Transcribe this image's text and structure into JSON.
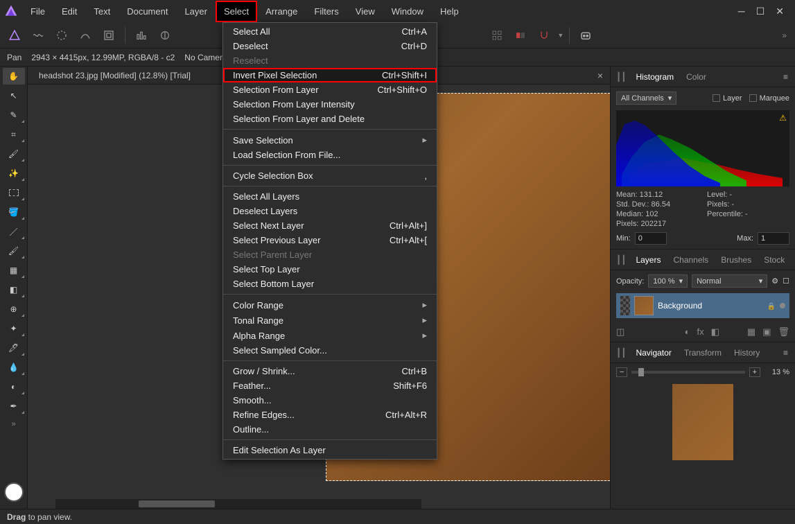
{
  "menu": [
    "File",
    "Edit",
    "Text",
    "Document",
    "Layer",
    "Select",
    "Arrange",
    "Filters",
    "View",
    "Window",
    "Help"
  ],
  "menu_selected_index": 5,
  "dropdown": {
    "groups": [
      [
        {
          "label": "Select All",
          "shortcut": "Ctrl+A"
        },
        {
          "label": "Deselect",
          "shortcut": "Ctrl+D"
        },
        {
          "label": "Reselect",
          "shortcut": "",
          "disabled": true
        },
        {
          "label": "Invert Pixel Selection",
          "shortcut": "Ctrl+Shift+I",
          "highlighted": true
        },
        {
          "label": "Selection From Layer",
          "shortcut": "Ctrl+Shift+O"
        },
        {
          "label": "Selection From Layer Intensity",
          "shortcut": ""
        },
        {
          "label": "Selection From Layer and Delete",
          "shortcut": ""
        }
      ],
      [
        {
          "label": "Save Selection",
          "shortcut": "",
          "submenu": true
        },
        {
          "label": "Load Selection From File...",
          "shortcut": ""
        }
      ],
      [
        {
          "label": "Cycle Selection Box",
          "shortcut": ",",
          "kbd": "."
        }
      ],
      [
        {
          "label": "Select All Layers",
          "shortcut": ""
        },
        {
          "label": "Deselect Layers",
          "shortcut": ""
        },
        {
          "label": "Select Next Layer",
          "shortcut": "Ctrl+Alt+]"
        },
        {
          "label": "Select Previous Layer",
          "shortcut": "Ctrl+Alt+["
        },
        {
          "label": "Select Parent Layer",
          "shortcut": "",
          "disabled": true
        },
        {
          "label": "Select Top Layer",
          "shortcut": ""
        },
        {
          "label": "Select Bottom Layer",
          "shortcut": ""
        }
      ],
      [
        {
          "label": "Color Range",
          "shortcut": "",
          "submenu": true
        },
        {
          "label": "Tonal Range",
          "shortcut": "",
          "submenu": true
        },
        {
          "label": "Alpha Range",
          "shortcut": "",
          "submenu": true
        },
        {
          "label": "Select Sampled Color...",
          "shortcut": ""
        }
      ],
      [
        {
          "label": "Grow / Shrink...",
          "shortcut": "Ctrl+B"
        },
        {
          "label": "Feather...",
          "shortcut": "Shift+F6"
        },
        {
          "label": "Smooth...",
          "shortcut": ""
        },
        {
          "label": "Refine Edges...",
          "shortcut": "Ctrl+Alt+R"
        },
        {
          "label": "Outline...",
          "shortcut": ""
        }
      ],
      [
        {
          "label": "Edit Selection As Layer",
          "shortcut": ""
        }
      ]
    ]
  },
  "context_bar": {
    "tool_name": "Pan",
    "doc_info": "2943 × 4415px, 12.99MP, RGBA/8 - c2",
    "camera": "No Camera…"
  },
  "document_tab": {
    "title": "headshot 23.jpg [Modified] (12.8%) [Trial]"
  },
  "panels": {
    "histogram": {
      "tabs": [
        "Histogram",
        "Color"
      ],
      "active_tab": 0,
      "channel": "All Channels",
      "layer_check_label": "Layer",
      "marquee_check_label": "Marquee",
      "stats": {
        "mean_label": "Mean:",
        "mean": "131.12",
        "level_label": "Level:",
        "level": "-",
        "std_label": "Std. Dev.:",
        "std": "86.54",
        "pixels_label": "Pixels:",
        "pixels": "-",
        "median_label": "Median:",
        "median": "102",
        "percentile_label": "Percentile:",
        "percentile": "-",
        "pixcount_label": "Pixels:",
        "pixcount": "202217"
      },
      "min_label": "Min:",
      "min": "0",
      "max_label": "Max:",
      "max": "1"
    },
    "layers": {
      "tabs": [
        "Layers",
        "Channels",
        "Brushes",
        "Stock"
      ],
      "active_tab": 0,
      "opacity_label": "Opacity:",
      "opacity": "100 %",
      "blend": "Normal",
      "layer_name": "Background"
    },
    "navigator": {
      "tabs": [
        "Navigator",
        "Transform",
        "History"
      ],
      "active_tab": 0,
      "zoom": "13 %"
    }
  },
  "statusbar": {
    "hint": "Drag to pan view.",
    "hint_strong": "Drag"
  }
}
